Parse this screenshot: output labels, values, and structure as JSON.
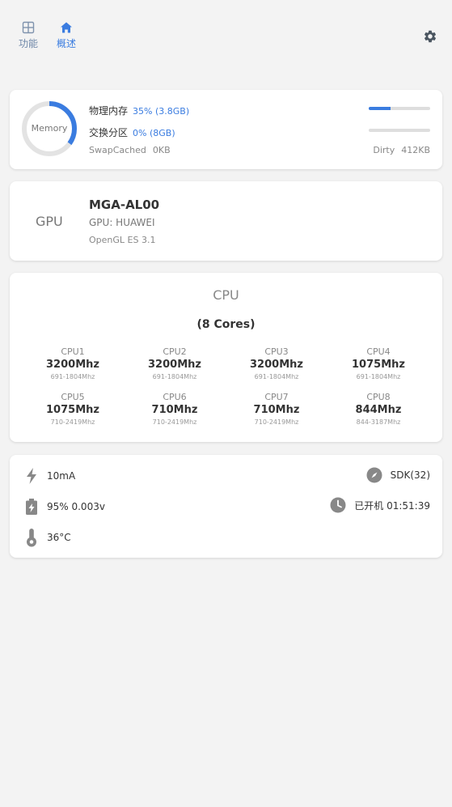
{
  "nav": {
    "tabs": [
      {
        "label": "功能",
        "icon": "grid-icon"
      },
      {
        "label": "概述",
        "icon": "home-icon"
      }
    ],
    "settings_icon": "gear-icon"
  },
  "memory": {
    "ring_label": "Memory",
    "used_fraction": 0.35,
    "physical_label": "物理内存",
    "physical_value": "35% (3.8GB)",
    "physical_fraction": 0.35,
    "swap_label": "交换分区",
    "swap_value": "0% (8GB)",
    "swap_fraction": 0.0,
    "swapcached_label": "SwapCached",
    "swapcached_value": "0KB",
    "dirty_label": "Dirty",
    "dirty_value": "412KB"
  },
  "gpu": {
    "title": "GPU",
    "model": "MGA-AL00",
    "vendor": "GPU: HUAWEI",
    "opengl": "OpenGL ES 3.1"
  },
  "cpu": {
    "title": "CPU",
    "cores_label": "(8 Cores)",
    "cores": [
      {
        "name": "CPU1",
        "freq": "3200Mhz",
        "range": "691-1804Mhz"
      },
      {
        "name": "CPU2",
        "freq": "3200Mhz",
        "range": "691-1804Mhz"
      },
      {
        "name": "CPU3",
        "freq": "3200Mhz",
        "range": "691-1804Mhz"
      },
      {
        "name": "CPU4",
        "freq": "1075Mhz",
        "range": "691-1804Mhz"
      },
      {
        "name": "CPU5",
        "freq": "1075Mhz",
        "range": "710-2419Mhz"
      },
      {
        "name": "CPU6",
        "freq": "710Mhz",
        "range": "710-2419Mhz"
      },
      {
        "name": "CPU7",
        "freq": "710Mhz",
        "range": "710-2419Mhz"
      },
      {
        "name": "CPU8",
        "freq": "844Mhz",
        "range": "844-3187Mhz"
      }
    ]
  },
  "status": {
    "current": "10mA",
    "battery": "95% 0.003v",
    "temperature": "36°C",
    "sdk": "SDK(32)",
    "uptime": "已开机 01:51:39"
  },
  "colors": {
    "accent": "#3a7ce0",
    "background": "#f3f3f3",
    "icon_gray": "#888888"
  }
}
